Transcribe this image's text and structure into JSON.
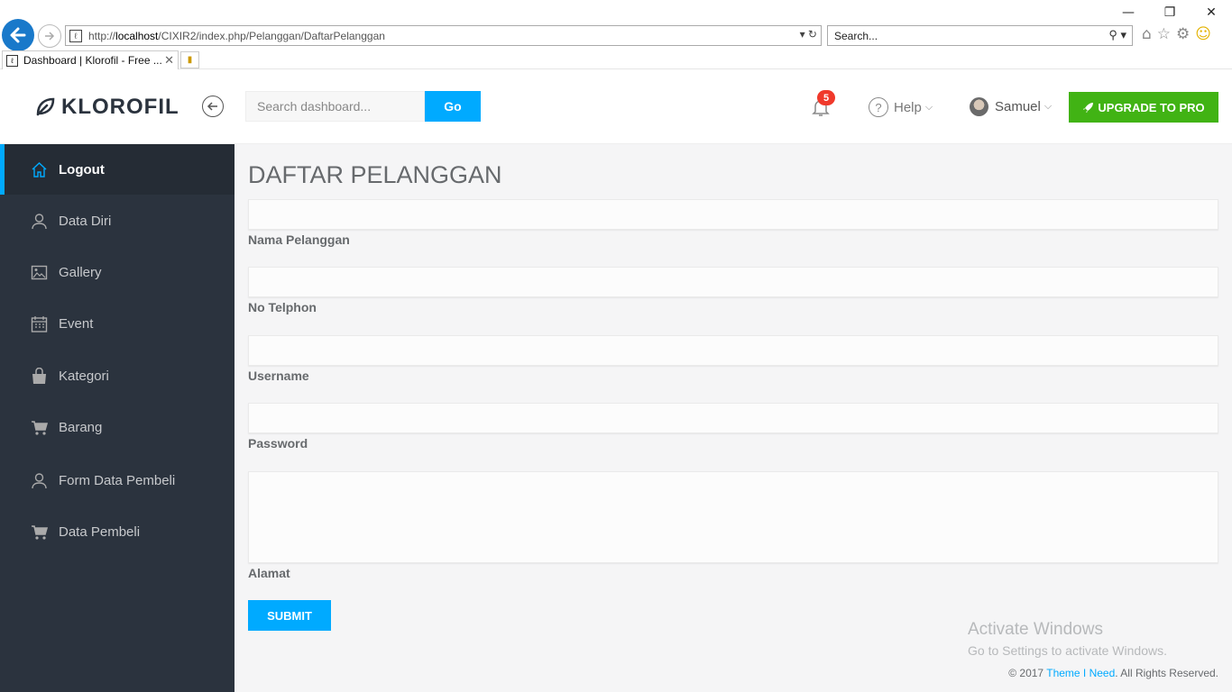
{
  "browser": {
    "url_prefix": "http://",
    "url_host": "localhost",
    "url_path": "/CIXIR2/index.php/Pelanggan/DaftarPelanggan",
    "search_placeholder": "Search...",
    "tab_title": "Dashboard | Klorofil - Free ...",
    "win_minimize": "—",
    "win_restore": "❐",
    "win_close": "✕"
  },
  "header": {
    "brand": "KLOROFIL",
    "search_placeholder": "Search dashboard...",
    "go_label": "Go",
    "notif_count": "5",
    "help_label": "Help",
    "user_name": "Samuel",
    "upgrade_label": "UPGRADE TO PRO"
  },
  "sidebar": {
    "items": [
      {
        "label": "Logout",
        "icon": "home-icon",
        "active": true
      },
      {
        "label": "Data Diri",
        "icon": "user-icon"
      },
      {
        "label": "Gallery",
        "icon": "image-icon"
      },
      {
        "label": "Event",
        "icon": "calendar-icon"
      },
      {
        "label": "Kategori",
        "icon": "bag-icon"
      },
      {
        "label": "Barang",
        "icon": "cart-icon"
      },
      {
        "label": "Form Data Pembeli",
        "icon": "user-icon"
      },
      {
        "label": "Data Pembeli",
        "icon": "cart-icon"
      }
    ]
  },
  "main": {
    "title": "DAFTAR PELANGGAN",
    "fields": [
      {
        "label": "Nama Pelanggan",
        "value": ""
      },
      {
        "label": "No Telphon",
        "value": ""
      },
      {
        "label": "Username",
        "value": ""
      },
      {
        "label": "Password",
        "value": ""
      },
      {
        "label": "Alamat",
        "value": ""
      }
    ],
    "submit_label": "SUBMIT"
  },
  "watermark": {
    "line1": "Activate Windows",
    "line2": "Go to Settings to activate Windows."
  },
  "footer": {
    "prefix": "© 2017 ",
    "link": "Theme I Need",
    "suffix": ". All Rights Reserved."
  },
  "colors": {
    "accent": "#00aaff",
    "upgrade": "#41b314",
    "sidebar_bg": "#2b333e",
    "badge": "#f0392b"
  }
}
